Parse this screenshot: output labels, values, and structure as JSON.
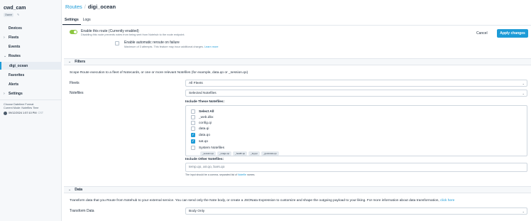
{
  "project": {
    "name": "cwd_cam",
    "badge": "Owner",
    "pin_icon": "pin-icon"
  },
  "sidebar": {
    "items": [
      {
        "label": "Devices",
        "chevron": ""
      },
      {
        "label": "Fleets",
        "chevron": "›"
      },
      {
        "label": "Events",
        "chevron": ""
      },
      {
        "label": "Routes",
        "chevron": "⌄"
      },
      {
        "label": "digi_ocean",
        "chevron": ""
      },
      {
        "label": "Favorites",
        "chevron": ""
      },
      {
        "label": "Alerts",
        "chevron": ""
      },
      {
        "label": "Settings",
        "chevron": "›"
      }
    ],
    "datetime": {
      "title": "Choose Datetime Format",
      "mode": "Current Mode: Notefiles Time",
      "value": "09/12/2024 1:57:10 PM",
      "tz": "CST"
    }
  },
  "header": {
    "breadcrumb_root": "Routes",
    "breadcrumb_sep": "/",
    "breadcrumb_current": "digi_ocean"
  },
  "tabs": [
    {
      "label": "Settings"
    },
    {
      "label": "Logs"
    }
  ],
  "enable": {
    "title": "Enable this route (Currently enabled)",
    "desc": "Disabling this route prevents notes from being sent from Notehub to the route endpoint.",
    "state": true
  },
  "buttons": {
    "cancel": "Cancel",
    "apply": "Apply changes"
  },
  "auto_reroute": {
    "title": "Enable automatic reroute on failure",
    "desc": "Maximum of 3 attempts. This feature may incur additional charges.",
    "link": "Learn more",
    "checked": false
  },
  "filters": {
    "heading": "Filters",
    "intro": "Scope Route execution to a fleet of Notecards, or one or more relevant Notefiles (for example, data.qo or _session.qo)",
    "fleets_label": "Fleets",
    "fleets_value": "All Fleets",
    "notefiles_label": "Notefiles",
    "notefiles_value": "Selected Notefiles",
    "include_label": "Include These Notefiles:",
    "notefiles": [
      {
        "name": "Select All",
        "checked": false,
        "bold": true
      },
      {
        "name": "_web.dbx",
        "checked": false,
        "bold": false
      },
      {
        "name": "config.qi",
        "checked": false,
        "bold": false
      },
      {
        "name": "data.qi",
        "checked": false,
        "bold": false
      },
      {
        "name": "data.qo",
        "checked": true,
        "bold": false
      },
      {
        "name": "sat.qo",
        "checked": true,
        "bold": false
      },
      {
        "name": "System Notefiles",
        "checked": false,
        "bold": false
      }
    ],
    "system_chips": [
      "_session.qo",
      "_usage.qo",
      "_health.qo",
      "_log.qo",
      "_geolocate.qo"
    ],
    "other_label": "Include Other Notefiles:",
    "other_placeholder": "temp.qo, air.qo, bars.qo",
    "hint_prefix": "The input should be a comma- separated list of",
    "hint_link": "Notefile",
    "hint_suffix": "names."
  },
  "data_section": {
    "heading": "Data",
    "intro": "Transform data that you Route from Notehub to your external service. You can send only the Note body, or create a JSONata Expression to customize and shape the outgoing payload to your liking. For more information about data transformation,",
    "intro_link": "click here",
    "transform_label": "Transform Data",
    "transform_value": "Body Only"
  },
  "colors": {
    "accent": "#1d9bd7",
    "toggle_on": "#8cc63f"
  }
}
